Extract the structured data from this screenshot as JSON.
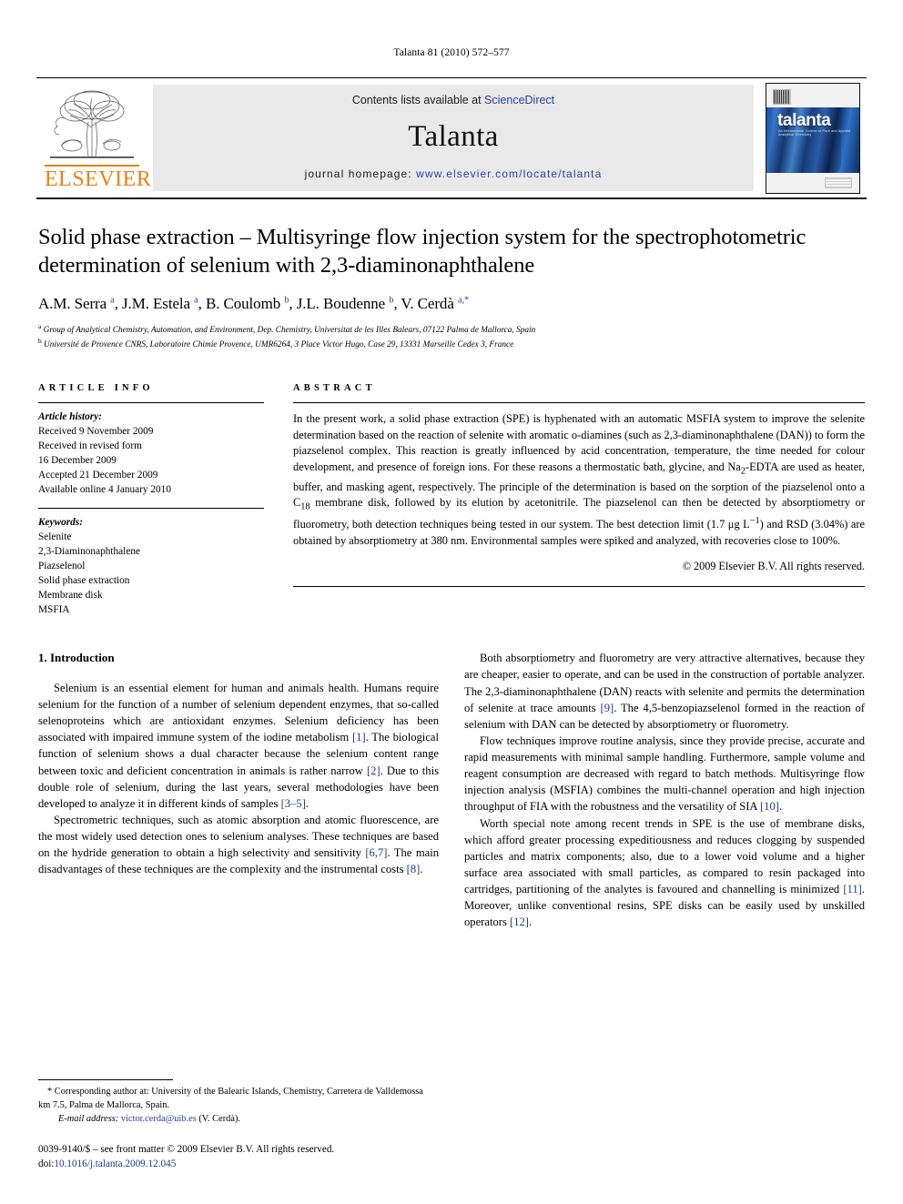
{
  "running_head": "Talanta 81 (2010) 572–577",
  "header": {
    "contents_prefix": "Contents lists available at ",
    "sciencedirect": "ScienceDirect",
    "journal_name": "Talanta",
    "homepage_prefix": "journal homepage: ",
    "homepage_url": "www.elsevier.com/locate/talanta",
    "publisher": "ELSEVIER",
    "cover_title": "talanta",
    "cover_subtitle": "An International Journal of Pure and Applied Analytical Chemistry",
    "link_color": "#2b3fa0",
    "elsevier_orange": "#F07F13"
  },
  "article": {
    "title": "Solid phase extraction – Multisyringe flow injection system for the spectrophotometric determination of selenium with 2,3-diaminonaphthalene",
    "authors_html": "A.M. Serra <sup>a</sup>, J.M. Estela <sup>a</sup>, B. Coulomb <sup>b</sup>, J.L. Boudenne <sup>b</sup>, V. Cerdà <sup>a,*</sup>",
    "affiliations": [
      "a Group of Analytical Chemistry, Automation, and Environment, Dep. Chemistry, Universitat de les Illes Balears, 07122 Palma de Mallorca, Spain",
      "b Université de Provence CNRS, Laboratoire Chimie Provence, UMR6264, 3 Place Victor Hugo, Case 29, 13331 Marseille Cedex 3, France"
    ]
  },
  "article_info": {
    "heading": "ARTICLE INFO",
    "history_label": "Article history:",
    "history": [
      "Received 9 November 2009",
      "Received in revised form",
      "16 December 2009",
      "Accepted 21 December 2009",
      "Available online 4 January 2010"
    ],
    "keywords_label": "Keywords:",
    "keywords": [
      "Selenite",
      "2,3-Diaminonaphthalene",
      "Piazselenol",
      "Solid phase extraction",
      "Membrane disk",
      "MSFIA"
    ]
  },
  "abstract": {
    "heading": "ABSTRACT",
    "text_html": "In the present work, a solid phase extraction (SPE) is hyphenated with an automatic MSFIA system to improve the selenite determination based on the reaction of selenite with aromatic o-diamines (such as 2,3-diaminonaphthalene (DAN)) to form the piazselenol complex. This reaction is greatly influenced by acid concentration, temperature, the time needed for colour development, and presence of foreign ions. For these reasons a thermostatic bath, glycine, and Na<sub>2</sub>-EDTA are used as heater, buffer, and masking agent, respectively. The principle of the determination is based on the sorption of the piazselenol onto a C<sub>18</sub> membrane disk, followed by its elution by acetonitrile. The piazselenol can then be detected by absorptiometry or fluorometry, both detection techniques being tested in our system. The best detection limit (1.7 &mu;g L<sup>&minus;1</sup>) and RSD (3.04%) are obtained by absorptiometry at 380 nm. Environmental samples were spiked and analyzed, with recoveries close to 100%.",
    "copyright": "© 2009 Elsevier B.V. All rights reserved."
  },
  "body": {
    "section_heading": "1. Introduction",
    "left_paragraphs_html": [
      "Selenium is an essential element for human and animals health. Humans require selenium for the function of a number of selenium dependent enzymes, that so-called selenoproteins which are antioxidant enzymes. Selenium deficiency has been associated with impaired immune system of the iodine metabolism <span class=\"ref\">[1]</span>. The biological function of selenium shows a dual character because the selenium content range between toxic and deficient concentration in animals is rather narrow <span class=\"ref\">[2]</span>. Due to this double role of selenium, during the last years, several methodologies have been developed to analyze it in different kinds of samples <span class=\"ref\">[3–5]</span>.",
      "Spectrometric techniques, such as atomic absorption and atomic fluorescence, are the most widely used detection ones to selenium analyses. These techniques are based on the hydride generation to obtain a high selectivity and sensitivity <span class=\"ref\">[6,7]</span>. The main disadvantages of these techniques are the complexity and the instrumental costs <span class=\"ref\">[8]</span>."
    ],
    "right_paragraphs_html": [
      "Both absorptiometry and fluorometry are very attractive alternatives, because they are cheaper, easier to operate, and can be used in the construction of portable analyzer. The 2,3-diaminonaphthalene (DAN) reacts with selenite and permits the determination of selenite at trace amounts <span class=\"ref\">[9]</span>. The 4,5-benzopiazselenol formed in the reaction of selenium with DAN can be detected by absorptiometry or fluorometry.",
      "Flow techniques improve routine analysis, since they provide precise, accurate and rapid measurements with minimal sample handling. Furthermore, sample volume and reagent consumption are decreased with regard to batch methods. Multisyringe flow injection analysis (MSFIA) combines the multi-channel operation and high injection throughput of FIA with the robustness and the versatility of SIA <span class=\"ref\">[10]</span>.",
      "Worth special note among recent trends in SPE is the use of membrane disks, which afford greater processing expeditiousness and reduces clogging by suspended particles and matrix components; also, due to a lower void volume and a higher surface area associated with small particles, as compared to resin packaged into cartridges, partitioning of the analytes is favoured and channelling is minimized <span class=\"ref\">[11]</span>. Moreover, unlike conventional resins, SPE disks can be easily used by unskilled operators <span class=\"ref\">[12]</span>."
    ]
  },
  "footer": {
    "corresponding_html": "* Corresponding author at: University of the Balearic Islands, Chemistry, Carretera de Valldemossa km 7.5, Palma de Mallorca, Spain.",
    "email_html": "<i>E-mail address:</i> <span class=\"mail\">victor.cerda@uib.es</span> (V. Cerdà).",
    "issn_html": "0039-9140/$ – see front matter © 2009 Elsevier B.V. All rights reserved.",
    "doi_html": "doi:<span class=\"doi-link\">10.1016/j.talanta.2009.12.045</span>"
  }
}
